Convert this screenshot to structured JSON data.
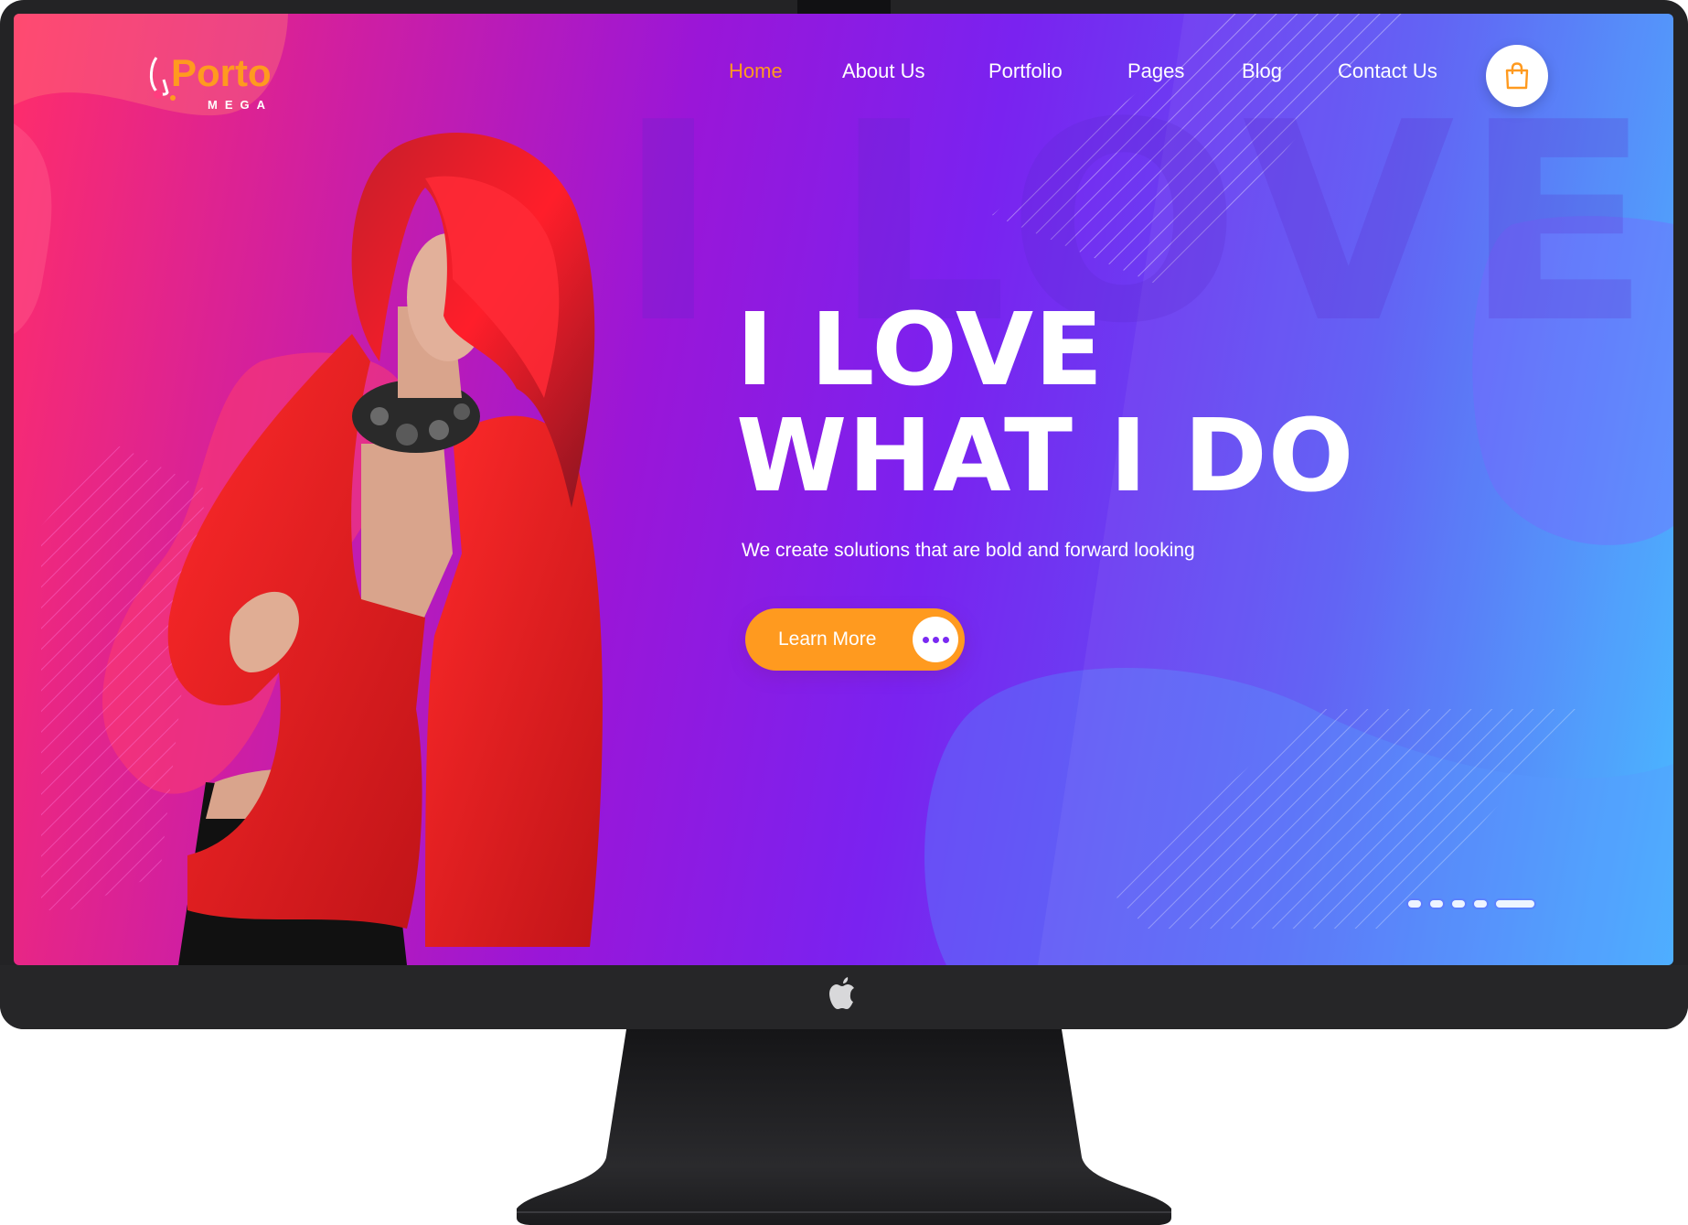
{
  "site": {
    "logo": {
      "word": "Porto",
      "sub": "MEGA"
    }
  },
  "nav": {
    "items": [
      {
        "label": "Home",
        "active": true
      },
      {
        "label": "About Us",
        "active": false
      },
      {
        "label": "Portfolio",
        "active": false
      },
      {
        "label": "Pages",
        "active": false
      },
      {
        "label": "Blog",
        "active": false
      },
      {
        "label": "Contact Us",
        "active": false
      }
    ],
    "cart_icon": "shopping-bag-icon"
  },
  "hero": {
    "watermark": "I LOVE",
    "title_line1": "I LOVE",
    "title_line2": "WHAT I DO",
    "subtitle": "We create solutions that are bold and forward looking",
    "cta_label": "Learn More",
    "cta_icon": "more-dots-icon"
  },
  "slider": {
    "slide_count": 5,
    "active_index": 4
  },
  "colors": {
    "accent": "#ff9a1f",
    "gradient_start": "#ff2d6a",
    "gradient_mid": "#7a22f0",
    "gradient_end": "#40b6ff",
    "bezel": "#232325"
  }
}
